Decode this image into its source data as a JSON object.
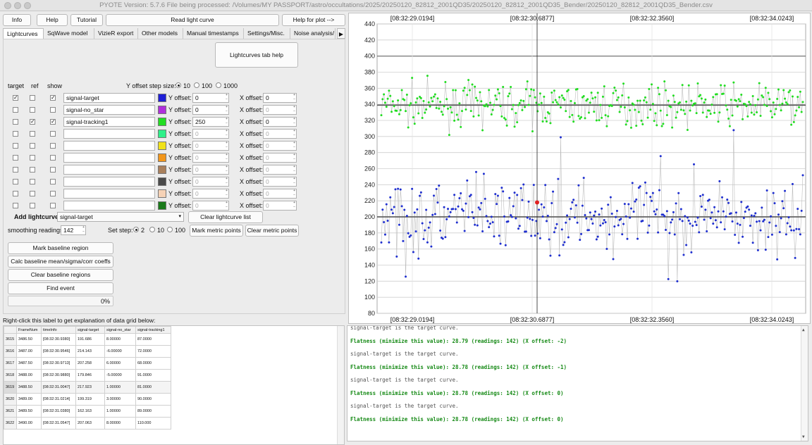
{
  "window": {
    "title": "PYOTE Version: 5.7.6  File being processed: /Volumes/MY PASSPORT/astro/occultations/2025/20250120_82812_2001QD35/20250120_82812_2001QD35_Bender/20250120_82812_2001QD35_Bender.csv"
  },
  "toolbar": {
    "info": "Info",
    "help": "Help",
    "tutorial": "Tutorial",
    "read_lightcurve": "Read light curve",
    "help_for_plot": "Help for plot -->"
  },
  "tabs": [
    "Lightcurves",
    "SqWave model",
    "VizieR export",
    "Other models",
    "Manual timestamps",
    "Settings/Misc.",
    "Noise analysis/"
  ],
  "panel": {
    "tab_help": "Lightcurves tab help",
    "col_target": "target",
    "col_ref": "ref",
    "col_show": "show",
    "y_step_label": "Y offset step size:",
    "y_step_options": [
      "10",
      "100",
      "1000"
    ],
    "y_offset_label": "Y offset:",
    "x_offset_label": "X offset:",
    "curves": [
      {
        "name": "signal-target",
        "color": "#1f1fd6",
        "target": true,
        "ref": false,
        "show": true,
        "yoff": "0",
        "xoff": "0",
        "active": true
      },
      {
        "name": "signal-no_star",
        "color": "#b02fdc",
        "target": false,
        "ref": false,
        "show": false,
        "yoff": "0",
        "xoff": "0",
        "active": true
      },
      {
        "name": "signal-tracking1",
        "color": "#22dd22",
        "target": false,
        "ref": true,
        "show": true,
        "yoff": "250",
        "xoff": "0",
        "active": true
      },
      {
        "name": "",
        "color": "#2ef089",
        "target": false,
        "ref": false,
        "show": false,
        "yoff": "0",
        "xoff": "0",
        "active": false
      },
      {
        "name": "",
        "color": "#f0e21a",
        "target": false,
        "ref": false,
        "show": false,
        "yoff": "0",
        "xoff": "0",
        "active": false
      },
      {
        "name": "",
        "color": "#f2961b",
        "target": false,
        "ref": false,
        "show": false,
        "yoff": "0",
        "xoff": "0",
        "active": false
      },
      {
        "name": "",
        "color": "#a9805c",
        "target": false,
        "ref": false,
        "show": false,
        "yoff": "0",
        "xoff": "0",
        "active": false
      },
      {
        "name": "",
        "color": "#4a4a4a",
        "target": false,
        "ref": false,
        "show": false,
        "yoff": "0",
        "xoff": "0",
        "active": false
      },
      {
        "name": "",
        "color": "#f6d2b6",
        "target": false,
        "ref": false,
        "show": false,
        "yoff": "0",
        "xoff": "0",
        "active": false
      },
      {
        "name": "",
        "color": "#1a7a1a",
        "target": false,
        "ref": false,
        "show": false,
        "yoff": "0",
        "xoff": "0",
        "active": false
      }
    ],
    "add_lightcurve_label": "Add lightcurve",
    "add_lightcurve_value": "signal-target",
    "clear_lightcurve_list": "Clear lightcurve list",
    "smoothing_label": "smoothing readings",
    "smoothing_value": "142",
    "set_step_label": "Set step:",
    "set_step_options": [
      "2",
      "10",
      "100"
    ],
    "mark_metric": "Mark metric points",
    "clear_metric": "Clear metric points",
    "mark_baseline": "Mark baseline region",
    "calc_baseline": "Calc baseline mean/sigma/corr coeffs",
    "clear_baseline": "Clear baseline regions",
    "find_event": "Find event",
    "progress": "0%"
  },
  "grid_hint": "Right-click this label to get explanation of data grid below:",
  "grid": {
    "headers": [
      "",
      "FrameNum",
      "timeInfo",
      "signal-target",
      "signal-no_star",
      "signal-tracking1"
    ],
    "rows": [
      [
        "3615",
        "3486.50",
        "[08:32:30.9380]",
        "191.686",
        "8.00000",
        "87.0000"
      ],
      [
        "3616",
        "3487.00",
        "[08:32:30.9546]",
        "214.143",
        "-6.00000",
        "72.0000"
      ],
      [
        "3617",
        "3487.50",
        "[08:32:30.9713]",
        "207.258",
        "6.00000",
        "68.0000"
      ],
      [
        "3618",
        "3488.00",
        "[08:32:30.9880]",
        "179.846",
        "-5.00000",
        "91.0000"
      ],
      [
        "3619",
        "3488.50",
        "[08:32:31.0047]",
        "217.923",
        "1.00000",
        "81.0000"
      ],
      [
        "3620",
        "3489.00",
        "[08:32:31.0214]",
        "199.319",
        "3.00000",
        "90.0000"
      ],
      [
        "3621",
        "3489.50",
        "[08:32:31.0380]",
        "162.163",
        "1.00000",
        "89.0000"
      ],
      [
        "3622",
        "3490.00",
        "[08:32:31.0547]",
        "207.063",
        "8.00000",
        "110.000"
      ]
    ]
  },
  "log": {
    "lines": [
      {
        "text": "signal-target is the target curve.",
        "style": "plain"
      },
      {
        "text": "Flatness (minimize this value): 28.79 (readings: 142) (X offset: -2)",
        "style": "green"
      },
      {
        "text": "signal-target is the target curve.",
        "style": "plain"
      },
      {
        "text": "Flatness (minimize this value): 28.78 (readings: 142) (X offset: -1)",
        "style": "green"
      },
      {
        "text": "signal-target is the target curve.",
        "style": "plain"
      },
      {
        "text": "Flatness (minimize this value): 28.78 (readings: 142) (X offset: 0)",
        "style": "green"
      },
      {
        "text": "signal-target is the target curve.",
        "style": "plain"
      },
      {
        "text": "Flatness (minimize this value): 28.78 (readings: 142) (X offset: 0)",
        "style": "green"
      }
    ]
  },
  "chart_data": {
    "type": "scatter",
    "top_ticks": [
      "[08:32:29.0194]",
      "[08:32:30.6877]",
      "[08:32:32.3560]",
      "[08:32:34.0243]"
    ],
    "bottom_ticks": [
      "[08:32:29.0194]",
      "[08:32:30.6877]",
      "[08:32:32.3560]",
      "[08:32:34.0243]"
    ],
    "ylim": [
      80,
      440
    ],
    "y_ticks": [
      80,
      100,
      120,
      140,
      160,
      180,
      200,
      220,
      240,
      260,
      280,
      300,
      320,
      340,
      360,
      380,
      400,
      420,
      440
    ],
    "grid": true,
    "cursor_tick_index": 1,
    "marked_point": {
      "y": 217.923
    },
    "series": [
      {
        "color": "#22dd22",
        "mean": 339,
        "spread": 18
      },
      {
        "color": "#1f2fcf",
        "mean": 200,
        "spread": 30
      }
    ]
  }
}
